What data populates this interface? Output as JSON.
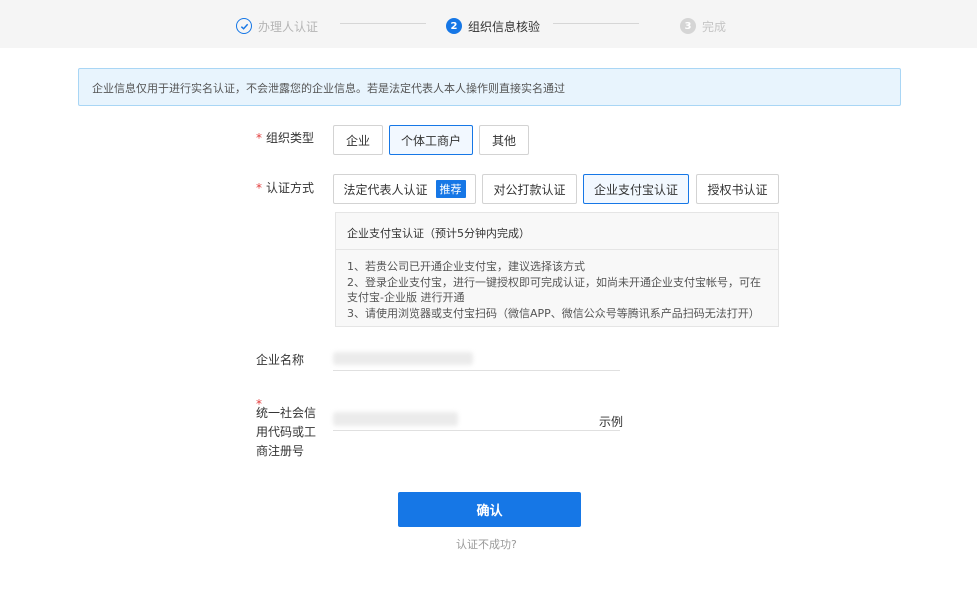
{
  "stepper": {
    "steps": [
      {
        "index": "✓",
        "label": "办理人认证",
        "state": "done"
      },
      {
        "index": "2",
        "label": "组织信息核验",
        "state": "active"
      },
      {
        "index": "3",
        "label": "完成",
        "state": "pending"
      }
    ]
  },
  "notice": {
    "text": "企业信息仅用于进行实名认证，不会泄露您的企业信息。若是法定代表人本人操作则直接实名通过"
  },
  "org_type": {
    "label": "组织类型",
    "options": [
      "企业",
      "个体工商户",
      "其他"
    ],
    "selected": "个体工商户"
  },
  "auth_method": {
    "label": "认证方式",
    "options": [
      {
        "label": "法定代表人认证",
        "badge": "推荐"
      },
      {
        "label": "对公打款认证"
      },
      {
        "label": "企业支付宝认证"
      },
      {
        "label": "授权书认证"
      }
    ],
    "selected": "企业支付宝认证"
  },
  "info_panel": {
    "title": "企业支付宝认证（预计5分钟内完成）",
    "lines": [
      "1、若贵公司已开通企业支付宝，建议选择该方式",
      "2、登录企业支付宝，进行一键授权即可完成认证，如尚未开通企业支付宝帐号，可在",
      "支付宝-企业版 进行开通",
      "3、请使用浏览器或支付宝扫码（微信APP、微信公众号等腾讯系产品扫码无法打开）"
    ]
  },
  "company_name": {
    "label": "企业名称"
  },
  "credit_code": {
    "label_lines": [
      "统一社会信",
      "用代码或工",
      "商注册号"
    ],
    "example": "示例"
  },
  "confirm_label": "确认",
  "fail_link": "认证不成功?",
  "colors": {
    "accent": "#1677e6",
    "required": "#e23c3c",
    "notice_bg": "#e8f4fd"
  }
}
